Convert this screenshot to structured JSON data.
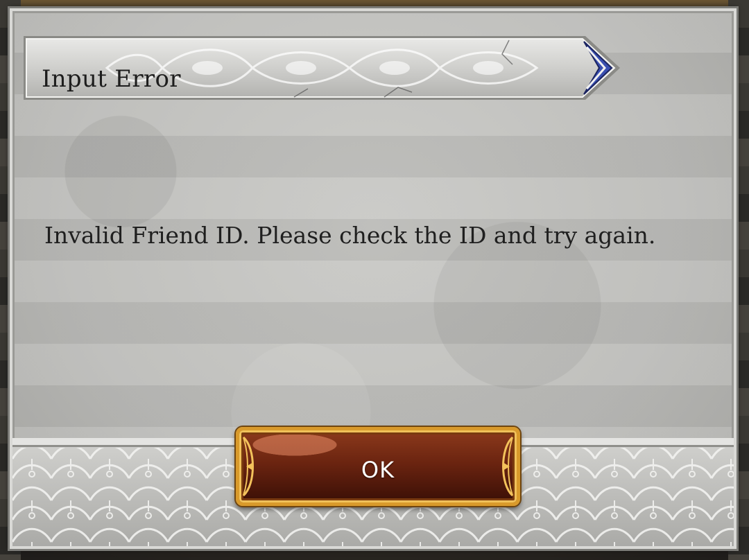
{
  "dialog": {
    "title": "Input Error",
    "message": "Invalid Friend ID. Please check the ID and try again.",
    "ok_label": "OK"
  },
  "colors": {
    "panel": "#c4c4c1",
    "banner_accent": "#3a4fb0",
    "button_fill": "#6b2410",
    "button_border": "#d99a2b",
    "text": "#1f1f1f"
  },
  "icons": {
    "banner_ornament": "stone-filigree",
    "button_corners": "gold-filigree"
  }
}
